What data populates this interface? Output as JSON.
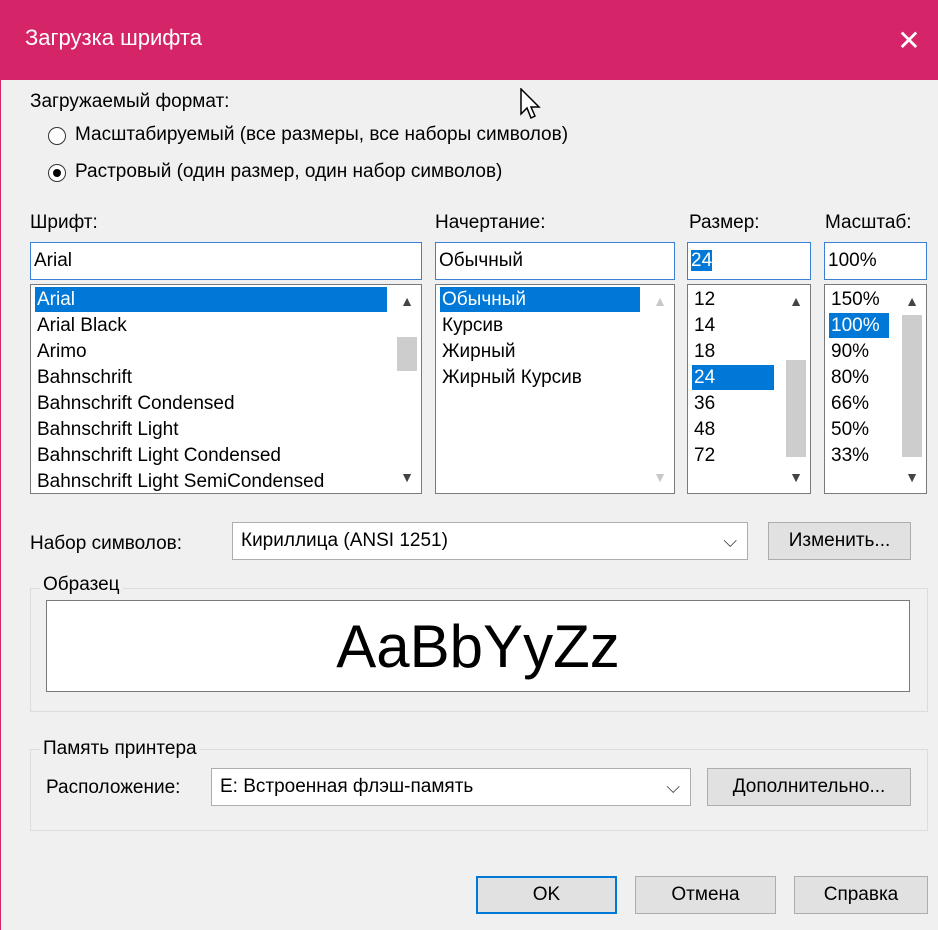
{
  "title": "Загрузка шрифта",
  "close_glyph": "✕",
  "format": {
    "label": "Загружаемый формат:",
    "options": [
      {
        "label": "Масштабируемый (все размеры, все наборы символов)",
        "selected": false
      },
      {
        "label": "Растровый (один размер, один набор символов)",
        "selected": true
      }
    ]
  },
  "font": {
    "label": "Шрифт:",
    "value": "Arial",
    "items": [
      "Arial",
      "Arial Black",
      "Arimo",
      "Bahnschrift",
      "Bahnschrift Condensed",
      "Bahnschrift Light",
      "Bahnschrift Light Condensed",
      "Bahnschrift Light SemiCondensed"
    ],
    "selected_index": 0
  },
  "style": {
    "label": "Начертание:",
    "value": "Обычный",
    "items": [
      "Обычный",
      "Курсив",
      "Жирный",
      "Жирный Курсив"
    ],
    "selected_index": 0
  },
  "size": {
    "label": "Размер:",
    "value": "24",
    "items": [
      "12",
      "14",
      "18",
      "24",
      "36",
      "48",
      "72"
    ],
    "selected_index": 3
  },
  "scale": {
    "label": "Масштаб:",
    "value": "100%",
    "items": [
      "150%",
      "100%",
      "90%",
      "80%",
      "66%",
      "50%",
      "33%"
    ],
    "selected_index": 1
  },
  "charset": {
    "label": "Набор символов:",
    "value": "Кириллица (ANSI 1251)",
    "change_button": "Изменить..."
  },
  "sample": {
    "caption": "Образец",
    "text": "AaBbYyZz"
  },
  "printer": {
    "caption": "Память принтера",
    "location_label": "Расположение:",
    "location_value": "E: Встроенная флэш-память",
    "advanced_button": "Дополнительно..."
  },
  "buttons": {
    "ok": "OK",
    "cancel": "Отмена",
    "help": "Справка"
  },
  "colors": {
    "titlebar": "#d52468",
    "selection": "#0078d7",
    "focus_border": "#3c7fd6"
  }
}
